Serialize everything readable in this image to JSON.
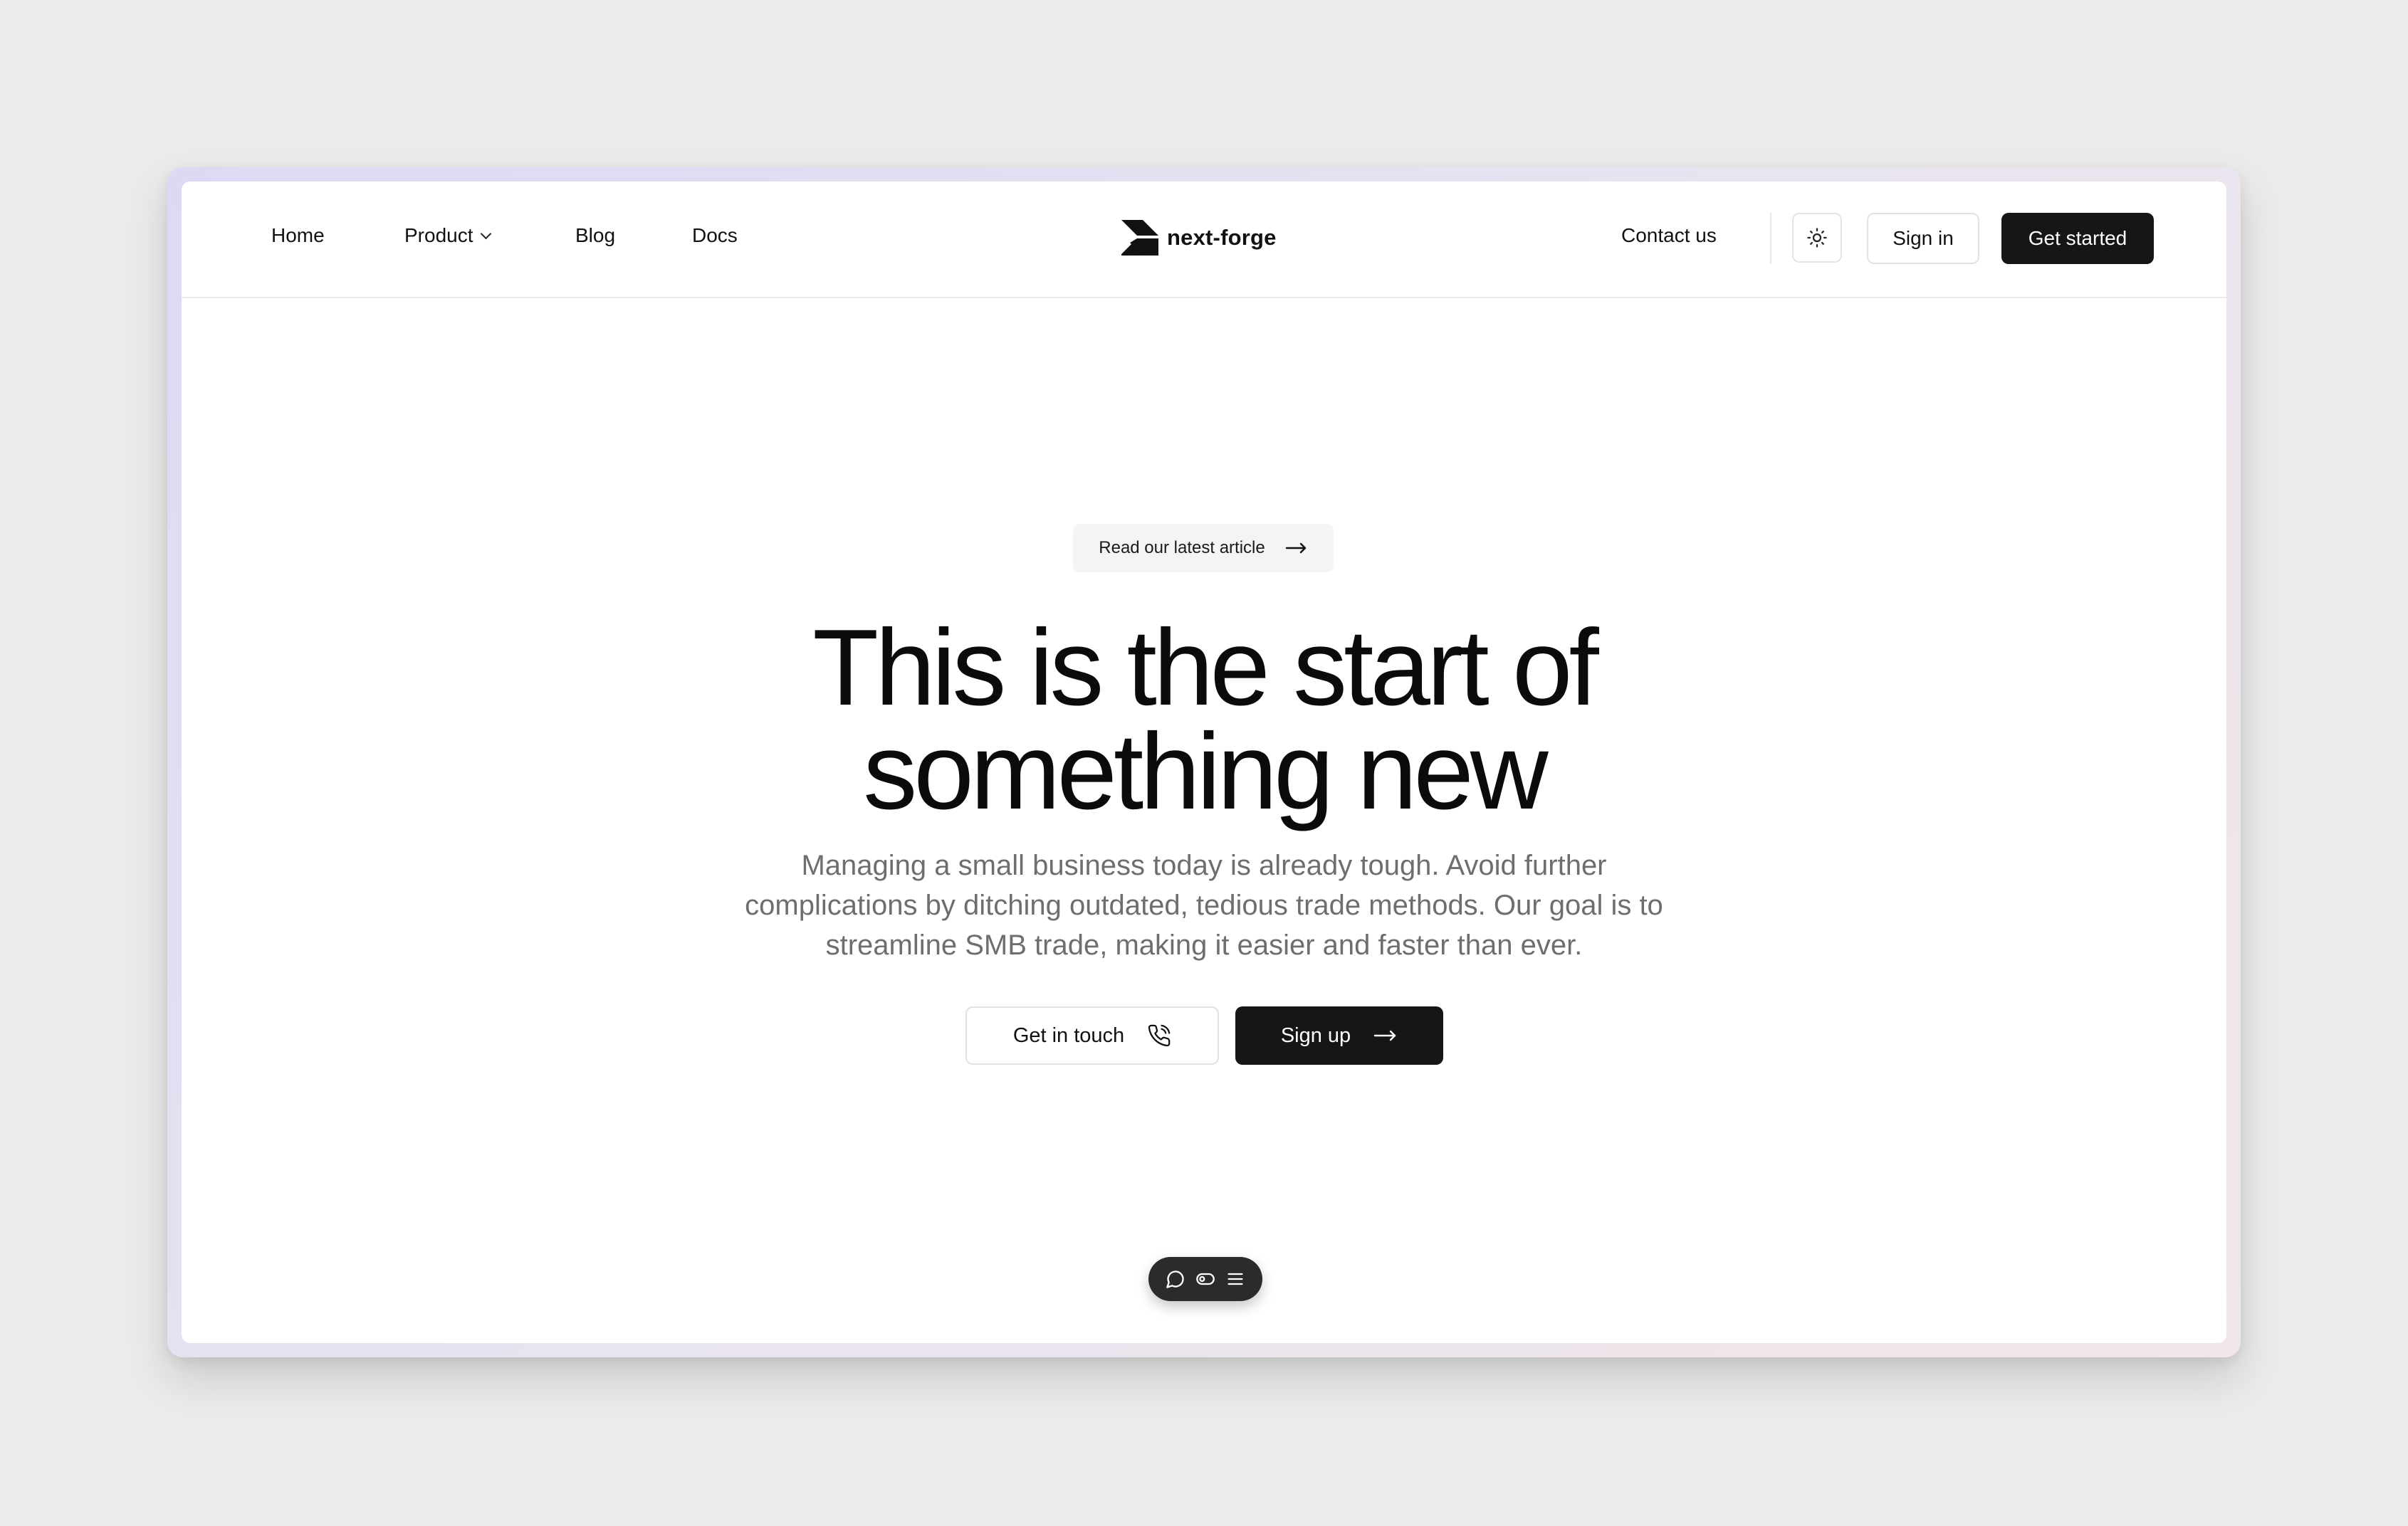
{
  "header": {
    "nav": [
      {
        "label": "Home"
      },
      {
        "label": "Product",
        "has_dropdown": true
      },
      {
        "label": "Blog"
      },
      {
        "label": "Docs"
      }
    ],
    "logo_text": "next-forge",
    "contact_label": "Contact us",
    "theme_toggle_icon": "sun-icon",
    "sign_in_label": "Sign in",
    "get_started_label": "Get started"
  },
  "hero": {
    "pill_label": "Read our latest article",
    "headline_line1": "This is the start of",
    "headline_line2": "something new",
    "subtext": "Managing a small business today is already tough. Avoid further complications by ditching outdated, tedious trade methods. Our goal is to streamline SMB trade, making it easier and faster than ever.",
    "cta_secondary_label": "Get in touch",
    "cta_secondary_icon": "phone-call-icon",
    "cta_primary_label": "Sign up",
    "cta_primary_icon": "arrow-right-icon"
  },
  "dock": {
    "icons": [
      "comment-icon",
      "toggle-icon",
      "menu-icon"
    ]
  },
  "colors": {
    "page_bg": "#ebebeb",
    "primary_dark": "#161616",
    "body_text": "#6e6e6e",
    "pill_bg": "#f4f4f4"
  }
}
